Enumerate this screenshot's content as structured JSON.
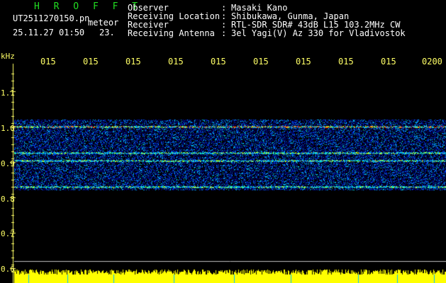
{
  "header": {
    "app_title": "H R O F F T",
    "filename": "UT2511270150.pn",
    "tag": "meteor",
    "datetime": "25.11.27 01:50",
    "value": "23.",
    "fields": [
      {
        "label": "Observer",
        "value": "Masaki Kano"
      },
      {
        "label": "Receiving Location",
        "value": "Shibukawa, Gunma, Japan"
      },
      {
        "label": "Receiver",
        "value": "RTL-SDR SDR# 43dB L15 103.2MHz CW"
      },
      {
        "label": "Receiving Antenna",
        "value": "3el Yagi(V) Az 330 for Vladivostok"
      }
    ]
  },
  "axis": {
    "unit": "kHz",
    "y_ticks": [
      "1.1",
      "1.0",
      "0.9",
      "0.8",
      "0.7",
      "0.6"
    ],
    "x_ticks": [
      "015",
      "015",
      "015",
      "015",
      "015",
      "015",
      "015",
      "015",
      "015",
      "0200"
    ]
  },
  "chart_data": {
    "type": "heatmap",
    "ylabel": "kHz",
    "ylim": [
      0.6,
      1.15
    ],
    "signal_band_khz": [
      0.82,
      1.02
    ],
    "strong_lines_khz": [
      1.0,
      0.925,
      0.905,
      0.83
    ]
  },
  "colors": {
    "background": "#000000",
    "text": "#ffffff",
    "title": "#22dd22",
    "ticks": "#ffff66",
    "power_bar": "#ffff00"
  }
}
